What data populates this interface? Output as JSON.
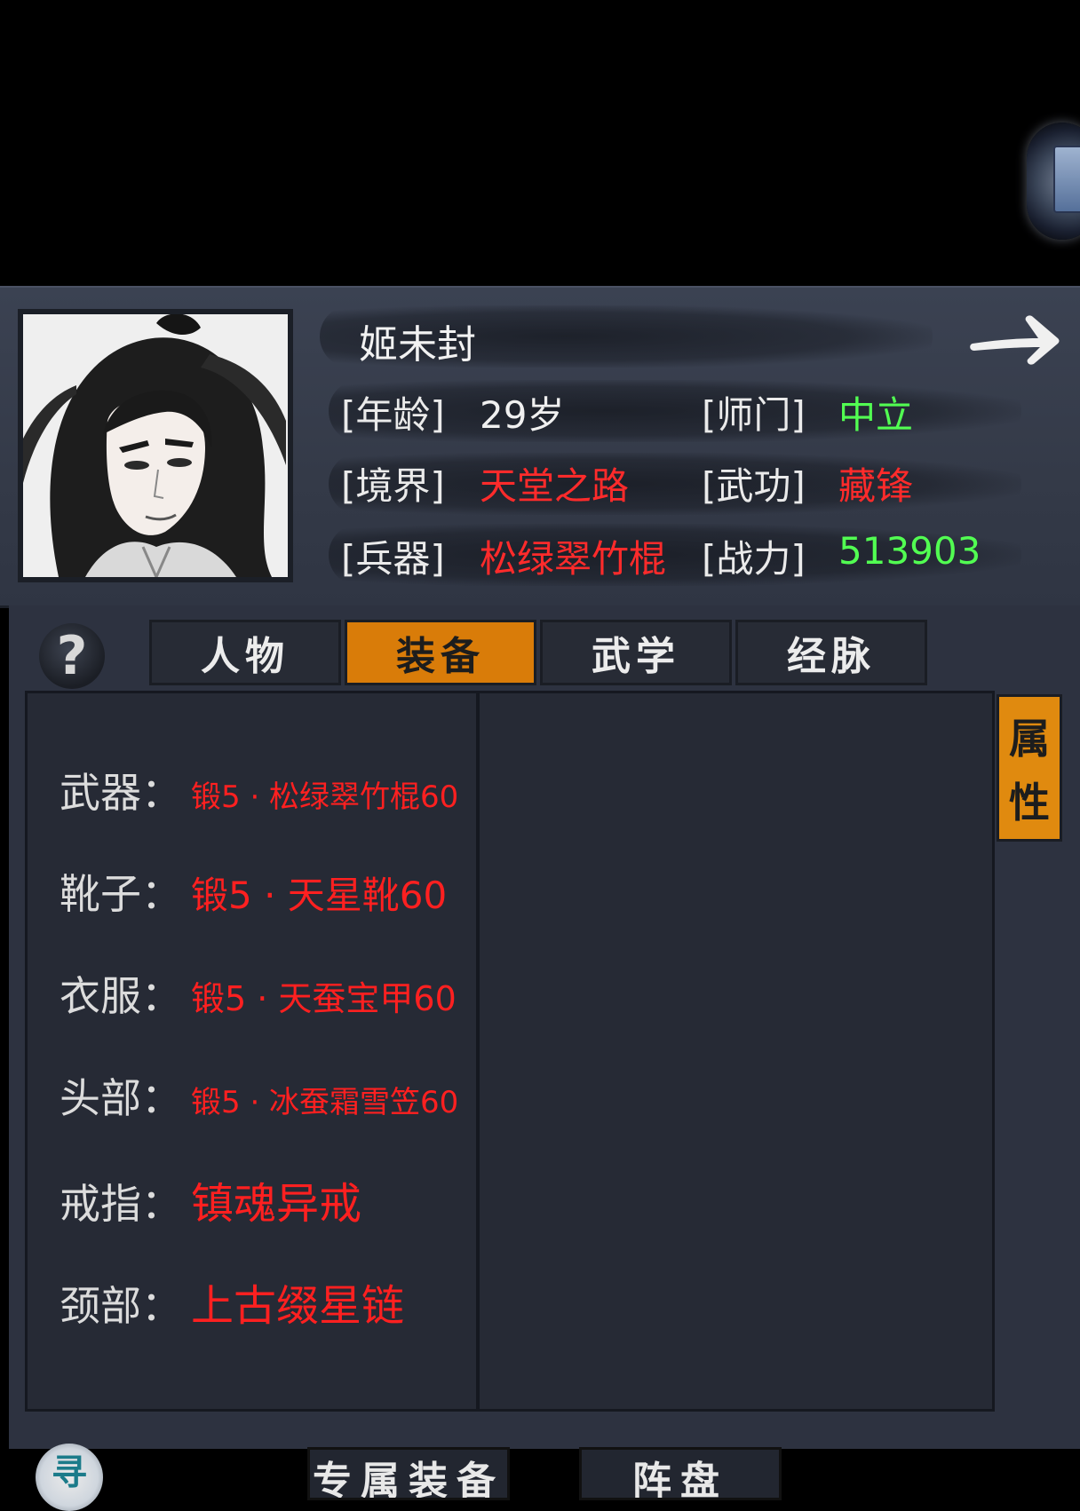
{
  "character": {
    "name": "姬未封",
    "age_label": "[年龄]",
    "age_value": "29岁",
    "school_label": "[师门]",
    "school_value": "中立",
    "realm_label": "[境界]",
    "realm_value": "天堂之路",
    "martial_label": "[武功]",
    "martial_value": "藏锋",
    "weapon_label": "[兵器]",
    "weapon_value": "松绿翠竹棍",
    "power_label": "[战力]",
    "power_value": "513903"
  },
  "help_symbol": "?",
  "tabs": [
    {
      "label": "人物",
      "active": false
    },
    {
      "label": "装备",
      "active": true
    },
    {
      "label": "武学",
      "active": false
    },
    {
      "label": "经脉",
      "active": false
    }
  ],
  "equipment": [
    {
      "slot": "武器：",
      "item": "锻5 · 松绿翠竹棍60"
    },
    {
      "slot": "靴子：",
      "item": "锻5 · 天星靴60"
    },
    {
      "slot": "衣服：",
      "item": "锻5 · 天蚕宝甲60"
    },
    {
      "slot": "头部：",
      "item": "锻5 · 冰蚕霜雪笠60"
    },
    {
      "slot": "戒指：",
      "item": "镇魂异戒"
    },
    {
      "slot": "颈部：",
      "item": "上古缀星链"
    }
  ],
  "side_tab": {
    "char1": "属",
    "char2": "性"
  },
  "bottom": {
    "circle_glyph": "寻",
    "button1": "专属装备",
    "button2": "阵盘"
  },
  "colors": {
    "accent_orange": "#d97c09",
    "item_red": "#ff2020",
    "value_green": "#52ff52"
  },
  "icons": [
    "arrow-right-icon",
    "question-icon"
  ]
}
